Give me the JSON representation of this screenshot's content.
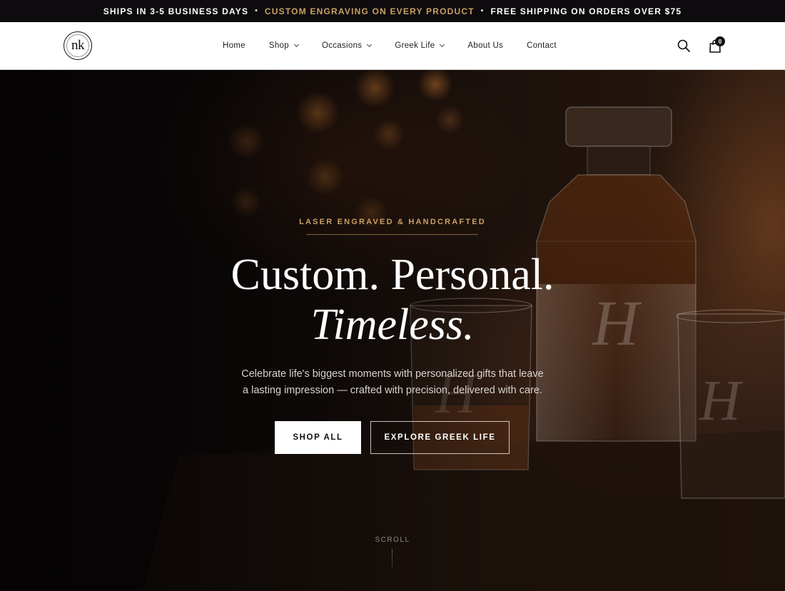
{
  "announcement": {
    "item1": "SHIPS IN 3-5 BUSINESS DAYS",
    "separator": "•",
    "item2": "CUSTOM ENGRAVING ON EVERY PRODUCT",
    "item3": "FREE SHIPPING ON ORDERS OVER $75"
  },
  "header": {
    "logo_text": "nk",
    "nav": [
      {
        "label": "Home",
        "has_dropdown": false
      },
      {
        "label": "Shop",
        "has_dropdown": true
      },
      {
        "label": "Occasions",
        "has_dropdown": true
      },
      {
        "label": "Greek Life",
        "has_dropdown": true
      },
      {
        "label": "About Us",
        "has_dropdown": false
      },
      {
        "label": "Contact",
        "has_dropdown": false
      }
    ],
    "icons": {
      "search": "search-icon",
      "cart": "shopping-bag-icon"
    },
    "cart_count": "0"
  },
  "hero": {
    "eyebrow": "LASER ENGRAVED & HANDCRAFTED",
    "headline_line1": "Custom. Personal.",
    "headline_line2": "Timeless.",
    "subtext_line1": "Celebrate life's biggest moments with personalized gifts that leave",
    "subtext_line2": "a lasting impression — crafted with precision, delivered with care.",
    "primary_button": "SHOP ALL",
    "secondary_button": "EXPLORE GREEK LIFE",
    "scroll_label": "SCROLL",
    "engraved_monogram": "H"
  },
  "colors": {
    "accent_gold": "#c9a063",
    "announcement_bg": "#0d0b0d",
    "header_bg": "#ffffff",
    "hero_bg": "#0b0809"
  }
}
